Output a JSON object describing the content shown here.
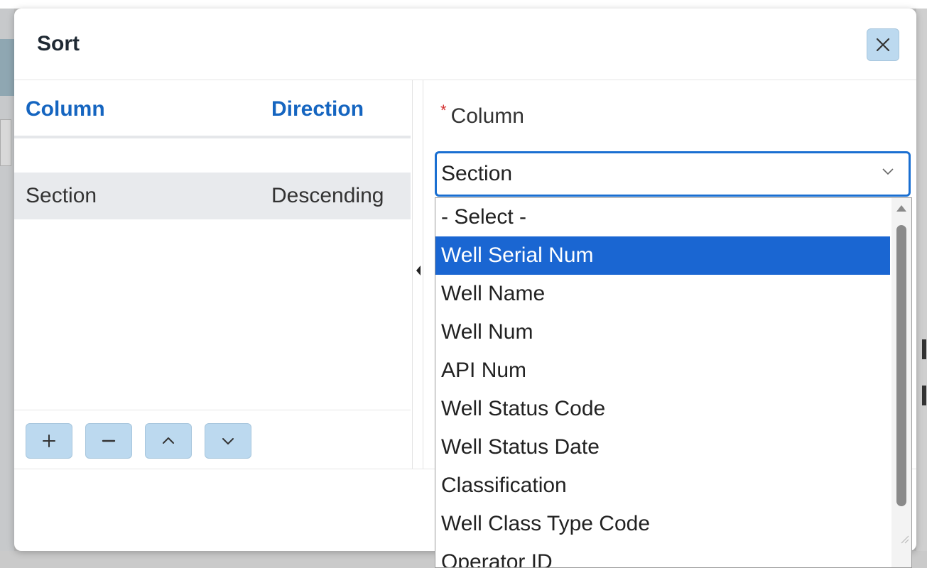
{
  "dialog": {
    "title": "Sort",
    "close_icon": "close-icon"
  },
  "sort_table": {
    "headers": {
      "column": "Column",
      "direction": "Direction"
    },
    "rows": [
      {
        "column": "Section",
        "direction": "Descending",
        "selected": true
      }
    ]
  },
  "toolbar": {
    "buttons": [
      {
        "name": "add-sort-button",
        "icon": "plus-icon"
      },
      {
        "name": "remove-sort-button",
        "icon": "minus-icon"
      },
      {
        "name": "move-up-button",
        "icon": "chevron-up-icon"
      },
      {
        "name": "move-down-button",
        "icon": "chevron-down-icon"
      }
    ]
  },
  "column_field": {
    "required_marker": "*",
    "label": "Column",
    "value": "Section"
  },
  "dropdown": {
    "options": [
      "- Select -",
      "Well Serial Num",
      "Well Name",
      "Well Num",
      "API Num",
      "Well Status Code",
      "Well Status Date",
      "Classification",
      "Well Class Type Code",
      "Operator ID"
    ],
    "highlighted_index": 1
  },
  "colors": {
    "accent": "#1565c0",
    "highlight": "#1a66d2",
    "button_bg": "#bcd9ef",
    "required": "#d32f2f"
  }
}
